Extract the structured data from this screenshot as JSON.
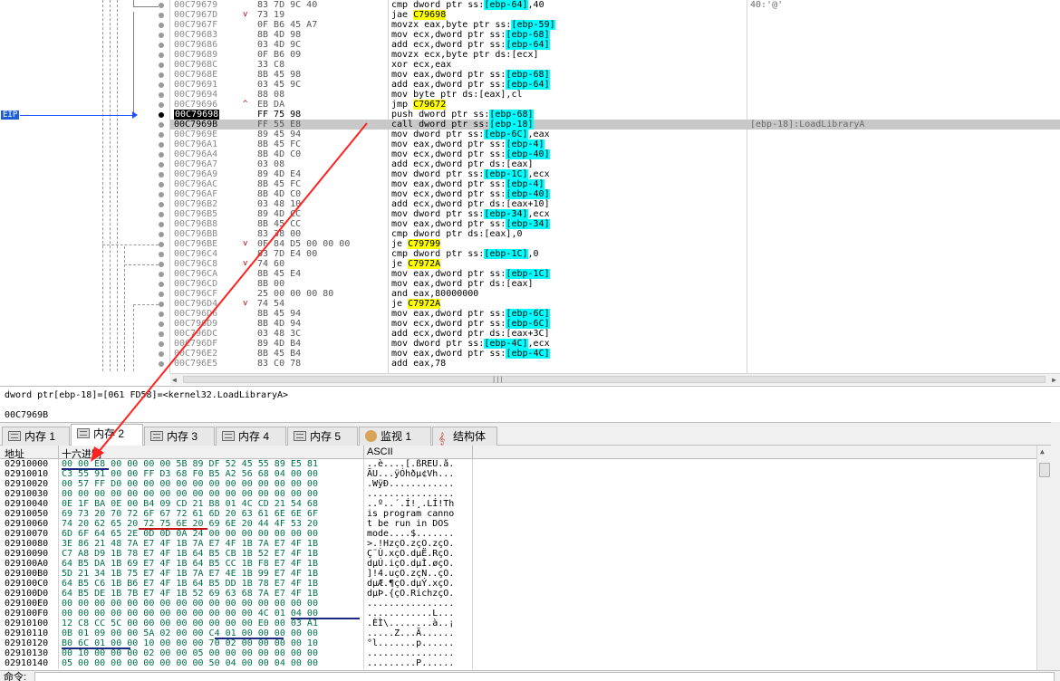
{
  "colors": {
    "eip_highlight": "#000000",
    "jump_highlight": "#ffff00",
    "stack_highlight": "#00ffff",
    "current_line": "#c8c8c8",
    "eip_arrow": "#2050ff",
    "annotation_arrow": "#ff2020",
    "hex_text": "#00704a"
  },
  "disasm": {
    "eip_label": "EIP",
    "rows": [
      {
        "addr": "00C79679",
        "mark": "",
        "bytes": "83 7D 9C 40",
        "mn": "cmp dword ptr ss:",
        "op": "[ebp-64]",
        "tail": ",40",
        "op_style": "bl",
        "comment": "40:'@'"
      },
      {
        "addr": "00C7967D",
        "mark": "v",
        "bytes": "73 19",
        "mn": "jae ",
        "op": "C79698",
        "tail": "",
        "op_style": "hl",
        "comment": ""
      },
      {
        "addr": "00C7967F",
        "mark": "",
        "bytes": "0F B6 45 A7",
        "mn": "movzx eax,byte ptr ss:",
        "op": "[ebp-59]",
        "tail": "",
        "op_style": "bl",
        "comment": ""
      },
      {
        "addr": "00C79683",
        "mark": "",
        "bytes": "8B 4D 98",
        "mn": "mov ecx,dword ptr ss:",
        "op": "[ebp-68]",
        "tail": "",
        "op_style": "bl",
        "comment": ""
      },
      {
        "addr": "00C79686",
        "mark": "",
        "bytes": "03 4D 9C",
        "mn": "add ecx,dword ptr ss:",
        "op": "[ebp-64]",
        "tail": "",
        "op_style": "bl",
        "comment": ""
      },
      {
        "addr": "00C79689",
        "mark": "",
        "bytes": "0F B6 09",
        "mn": "movzx ecx,byte ptr ds:[ecx]",
        "op": "",
        "tail": "",
        "op_style": "",
        "comment": ""
      },
      {
        "addr": "00C7968C",
        "mark": "",
        "bytes": "33 C8",
        "mn": "xor ecx,eax",
        "op": "",
        "tail": "",
        "op_style": "",
        "comment": ""
      },
      {
        "addr": "00C7968E",
        "mark": "",
        "bytes": "8B 45 98",
        "mn": "mov eax,dword ptr ss:",
        "op": "[ebp-68]",
        "tail": "",
        "op_style": "bl",
        "comment": ""
      },
      {
        "addr": "00C79691",
        "mark": "",
        "bytes": "03 45 9C",
        "mn": "add eax,dword ptr ss:",
        "op": "[ebp-64]",
        "tail": "",
        "op_style": "bl",
        "comment": ""
      },
      {
        "addr": "00C79694",
        "mark": "",
        "bytes": "88 08",
        "mn": "mov byte ptr ds:[eax],cl",
        "op": "",
        "tail": "",
        "op_style": "",
        "comment": ""
      },
      {
        "addr": "00C79696",
        "mark": "^",
        "bytes": "EB DA",
        "mn": "jmp ",
        "op": "C79672",
        "tail": "",
        "op_style": "hl",
        "comment": ""
      },
      {
        "addr": "00C79698",
        "mark": "",
        "bytes": "FF 75 98",
        "mn": "push dword ptr ss:",
        "op": "[ebp-68]",
        "tail": "",
        "op_style": "bl",
        "comment": "",
        "eip": true
      },
      {
        "addr": "00C7969B",
        "mark": "",
        "bytes": "FF 55 E8",
        "mn": "call dword ptr ss:",
        "op": "[ebp-18]",
        "tail": "",
        "op_style": "bl",
        "comment": "[ebp-18]:LoadLibraryA",
        "cur": true
      },
      {
        "addr": "00C7969E",
        "mark": "",
        "bytes": "89 45 94",
        "mn": "mov dword ptr ss:",
        "op": "[ebp-6C]",
        "tail": ",eax",
        "op_style": "bl",
        "comment": ""
      },
      {
        "addr": "00C796A1",
        "mark": "",
        "bytes": "8B 45 FC",
        "mn": "mov eax,dword ptr ss:",
        "op": "[ebp-4]",
        "tail": "",
        "op_style": "bl",
        "comment": ""
      },
      {
        "addr": "00C796A4",
        "mark": "",
        "bytes": "8B 4D C0",
        "mn": "mov ecx,dword ptr ss:",
        "op": "[ebp-40]",
        "tail": "",
        "op_style": "bl",
        "comment": ""
      },
      {
        "addr": "00C796A7",
        "mark": "",
        "bytes": "03 08",
        "mn": "add ecx,dword ptr ds:[eax]",
        "op": "",
        "tail": "",
        "op_style": "",
        "comment": ""
      },
      {
        "addr": "00C796A9",
        "mark": "",
        "bytes": "89 4D E4",
        "mn": "mov dword ptr ss:",
        "op": "[ebp-1C]",
        "tail": ",ecx",
        "op_style": "bl",
        "comment": ""
      },
      {
        "addr": "00C796AC",
        "mark": "",
        "bytes": "8B 45 FC",
        "mn": "mov eax,dword ptr ss:",
        "op": "[ebp-4]",
        "tail": "",
        "op_style": "bl",
        "comment": ""
      },
      {
        "addr": "00C796AF",
        "mark": "",
        "bytes": "8B 4D C0",
        "mn": "mov ecx,dword ptr ss:",
        "op": "[ebp-40]",
        "tail": "",
        "op_style": "bl",
        "comment": ""
      },
      {
        "addr": "00C796B2",
        "mark": "",
        "bytes": "03 48 10",
        "mn": "add ecx,dword ptr ds:[eax+10]",
        "op": "",
        "tail": "",
        "op_style": "",
        "comment": ""
      },
      {
        "addr": "00C796B5",
        "mark": "",
        "bytes": "89 4D CC",
        "mn": "mov dword ptr ss:",
        "op": "[ebp-34]",
        "tail": ",ecx",
        "op_style": "bl",
        "comment": ""
      },
      {
        "addr": "00C796B8",
        "mark": "",
        "bytes": "8B 45 CC",
        "mn": "mov eax,dword ptr ss:",
        "op": "[ebp-34]",
        "tail": "",
        "op_style": "bl",
        "comment": ""
      },
      {
        "addr": "00C796BB",
        "mark": "",
        "bytes": "83 38 00",
        "mn": "cmp dword ptr ds:[eax],0",
        "op": "",
        "tail": "",
        "op_style": "",
        "comment": ""
      },
      {
        "addr": "00C796BE",
        "mark": "v",
        "bytes": "0F 84 D5 00 00 00",
        "mn": "je ",
        "op": "C79799",
        "tail": "",
        "op_style": "hl",
        "comment": ""
      },
      {
        "addr": "00C796C4",
        "mark": "",
        "bytes": "83 7D E4 00",
        "mn": "cmp dword ptr ss:",
        "op": "[ebp-1C]",
        "tail": ",0",
        "op_style": "bl",
        "comment": ""
      },
      {
        "addr": "00C796C8",
        "mark": "v",
        "bytes": "74 60",
        "mn": "je ",
        "op": "C7972A",
        "tail": "",
        "op_style": "hl",
        "comment": ""
      },
      {
        "addr": "00C796CA",
        "mark": "",
        "bytes": "8B 45 E4",
        "mn": "mov eax,dword ptr ss:",
        "op": "[ebp-1C]",
        "tail": "",
        "op_style": "bl",
        "comment": ""
      },
      {
        "addr": "00C796CD",
        "mark": "",
        "bytes": "8B 00",
        "mn": "mov eax,dword ptr ds:[eax]",
        "op": "",
        "tail": "",
        "op_style": "",
        "comment": ""
      },
      {
        "addr": "00C796CF",
        "mark": "",
        "bytes": "25 00 00 00 80",
        "mn": "and eax,80000000",
        "op": "",
        "tail": "",
        "op_style": "",
        "comment": ""
      },
      {
        "addr": "00C796D4",
        "mark": "v",
        "bytes": "74 54",
        "mn": "je ",
        "op": "C7972A",
        "tail": "",
        "op_style": "hl",
        "comment": ""
      },
      {
        "addr": "00C796D6",
        "mark": "",
        "bytes": "8B 45 94",
        "mn": "mov eax,dword ptr ss:",
        "op": "[ebp-6C]",
        "tail": "",
        "op_style": "bl",
        "comment": ""
      },
      {
        "addr": "00C796D9",
        "mark": "",
        "bytes": "8B 4D 94",
        "mn": "mov ecx,dword ptr ss:",
        "op": "[ebp-6C]",
        "tail": "",
        "op_style": "bl",
        "comment": ""
      },
      {
        "addr": "00C796DC",
        "mark": "",
        "bytes": "03 48 3C",
        "mn": "add ecx,dword ptr ds:[eax+3C]",
        "op": "",
        "tail": "",
        "op_style": "",
        "comment": ""
      },
      {
        "addr": "00C796DF",
        "mark": "",
        "bytes": "89 4D B4",
        "mn": "mov dword ptr ss:",
        "op": "[ebp-4C]",
        "tail": ",ecx",
        "op_style": "bl",
        "comment": ""
      },
      {
        "addr": "00C796E2",
        "mark": "",
        "bytes": "8B 45 B4",
        "mn": "mov eax,dword ptr ss:",
        "op": "[ebp-4C]",
        "tail": "",
        "op_style": "bl",
        "comment": ""
      },
      {
        "addr": "00C796E5",
        "mark": "",
        "bytes": "83 C0 78",
        "mn": "add eax,78",
        "op": "",
        "tail": "",
        "op_style": "",
        "comment": ""
      }
    ]
  },
  "info": {
    "line1": "dword ptr[ebp-18]=[061 FD58]=<kernel32.LoadLibraryA>",
    "line2": "00C7969B"
  },
  "tabs": [
    {
      "label": "内存 1",
      "icon": "memory-icon"
    },
    {
      "label": "内存 2",
      "icon": "memory-icon",
      "active": true
    },
    {
      "label": "内存 3",
      "icon": "memory-icon"
    },
    {
      "label": "内存 4",
      "icon": "memory-icon"
    },
    {
      "label": "内存 5",
      "icon": "memory-icon"
    },
    {
      "label": "监视 1",
      "icon": "watch-icon"
    },
    {
      "label": "结构体",
      "icon": "struct-icon"
    }
  ],
  "dump": {
    "headers": {
      "address": "地址",
      "hex": "十六进制",
      "ascii": "ASCII"
    },
    "rows": [
      {
        "addr": "02910000",
        "hex": "00 00 E8 00 00 00 00 5B 89 DF 52 45 55 89 E5 81",
        "ascii": "..è....[.ßREU.å."
      },
      {
        "addr": "02910010",
        "hex": "C3 55 91 00 00 FF D3 68 F0 B5 A2 56 68 04 00 00",
        "ascii": "ÃU...ÿÓhðµ¢Vh..."
      },
      {
        "addr": "02910020",
        "hex": "00 57 FF D0 00 00 00 00 00 00 00 00 00 00 00 00",
        "ascii": ".WÿÐ............"
      },
      {
        "addr": "02910030",
        "hex": "00 00 00 00 00 00 00 00 00 00 00 00 00 00 00 00",
        "ascii": "................"
      },
      {
        "addr": "02910040",
        "hex": "0E 1F BA 0E 00 B4 09 CD 21 B8 01 4C CD 21 54 68",
        "ascii": "..º..´.Í!¸.LÍ!Th"
      },
      {
        "addr": "02910050",
        "hex": "69 73 20 70 72 6F 67 72 61 6D 20 63 61 6E 6E 6F",
        "ascii": "is program canno"
      },
      {
        "addr": "02910060",
        "hex": "74 20 62 65 20 72 75 6E 20 69 6E 20 44 4F 53 20",
        "ascii": "t be run in DOS "
      },
      {
        "addr": "02910070",
        "hex": "6D 6F 64 65 2E 0D 0D 0A 24 00 00 00 00 00 00 00",
        "ascii": "mode....$......."
      },
      {
        "addr": "02910080",
        "hex": "3E 86 21 48 7A E7 4F 1B 7A E7 4F 1B 7A E7 4F 1B",
        "ascii": ">.!HzçO.zçO.zçO."
      },
      {
        "addr": "02910090",
        "hex": "C7 A8 D9 1B 78 E7 4F 1B 64 B5 CB 1B 52 E7 4F 1B",
        "ascii": "Ç¨Ù.xçO.dµË.RçO."
      },
      {
        "addr": "029100A0",
        "hex": "64 B5 DA 1B 69 E7 4F 1B 64 B5 CC 1B F8 E7 4F 1B",
        "ascii": "dµÚ.içO.dµÌ.øçO."
      },
      {
        "addr": "029100B0",
        "hex": "5D 21 34 1B 75 E7 4F 1B 7A E7 4E 1B 99 E7 4F 1B",
        "ascii": "]!4.uçO.zçN..çO."
      },
      {
        "addr": "029100C0",
        "hex": "64 B5 C6 1B B6 E7 4F 1B 64 B5 DD 1B 78 E7 4F 1B",
        "ascii": "dµÆ.¶çO.dµÝ.xçO."
      },
      {
        "addr": "029100D0",
        "hex": "64 B5 DE 1B 7B E7 4F 1B 52 69 63 68 7A E7 4F 1B",
        "ascii": "dµÞ.{çO.RichzçO."
      },
      {
        "addr": "029100E0",
        "hex": "00 00 00 00 00 00 00 00 00 00 00 00 00 00 00 00",
        "ascii": "................"
      },
      {
        "addr": "029100F0",
        "hex": "00 00 00 00 00 00 00 00 00 00 00 00 4C 01 04 00",
        "ascii": "............L..."
      },
      {
        "addr": "02910100",
        "hex": "12 C8 CC 5C 00 00 00 00 00 00 00 00 E0 00 03 A1",
        "ascii": ".ÈÌ\\........à..¡"
      },
      {
        "addr": "02910110",
        "hex": "0B 01 09 00 00 5A 02 00 00 C4 01 00 00 00 00 00",
        "ascii": ".....Z...Ä......"
      },
      {
        "addr": "02910120",
        "hex": "B0 6C 01 00 00 10 00 00 00 70 02 00 00 00 00 10",
        "ascii": "°l.......p......"
      },
      {
        "addr": "02910130",
        "hex": "00 10 00 00 00 02 00 00 05 00 00 00 00 00 00 00",
        "ascii": "................"
      },
      {
        "addr": "02910140",
        "hex": "05 00 00 00 00 00 00 00 00 50 04 00 00 04 00 00",
        "ascii": ".........P......"
      }
    ]
  },
  "command": {
    "label": "命令:",
    "value": ""
  }
}
